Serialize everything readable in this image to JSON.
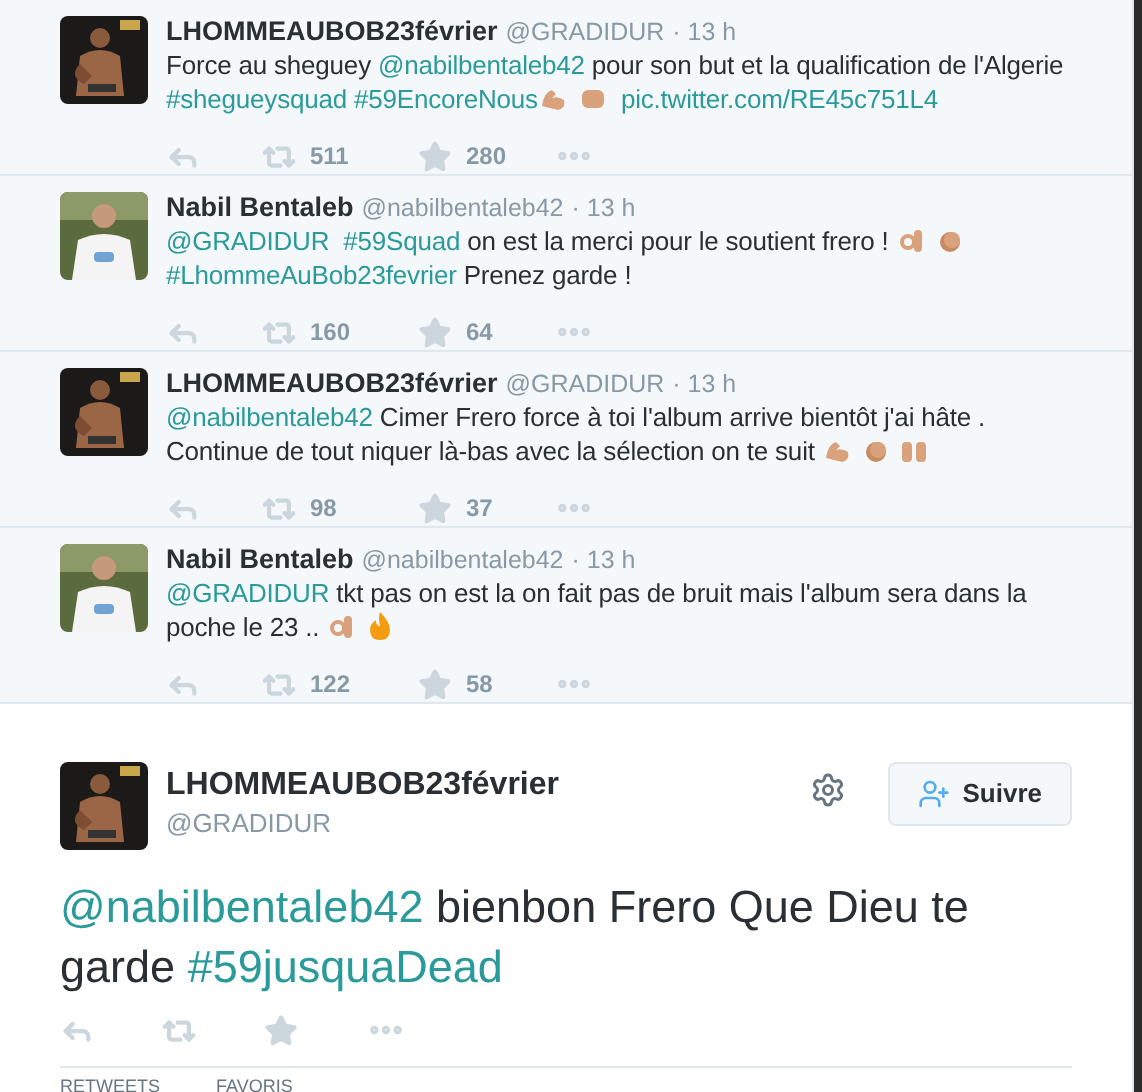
{
  "replies": [
    {
      "name": "LHOMMEAUBOB23février",
      "handle": "@GRADIDUR",
      "time": "· 13 h",
      "segments": [
        {
          "kind": "text",
          "text": "Force au sheguey "
        },
        {
          "kind": "link",
          "text": "@nabilbentaleb42"
        },
        {
          "kind": "text",
          "text": " pour son but et la qualification de l'Algerie "
        },
        {
          "kind": "link",
          "text": "#shegueysquad #59EncoreNous"
        },
        {
          "kind": "muscle"
        },
        {
          "kind": "fist"
        },
        {
          "kind": "link",
          "text": " pic.twitter.com/RE45c751L4"
        }
      ],
      "retweets": "511",
      "favorites": "280"
    },
    {
      "name": "Nabil Bentaleb",
      "handle": "@nabilbentaleb42",
      "time": "· 13 h",
      "segments": [
        {
          "kind": "link",
          "text": "@GRADIDUR  #59Squad"
        },
        {
          "kind": "text",
          "text": " on est la merci pour le soutient frero ! "
        },
        {
          "kind": "ok"
        },
        {
          "kind": "clap"
        },
        {
          "kind": "link",
          "text": "#LhommeAuBob23fevrier"
        },
        {
          "kind": "text",
          "text": " Prenez garde !"
        }
      ],
      "retweets": "160",
      "favorites": "64"
    },
    {
      "name": "LHOMMEAUBOB23février",
      "handle": "@GRADIDUR",
      "time": "· 13 h",
      "segments": [
        {
          "kind": "link",
          "text": "@nabilbentaleb42"
        },
        {
          "kind": "text",
          "text": " Cimer Frero force à toi l'album arrive bientôt j'ai hâte . Continue de tout niquer là-bas avec la sélection on te suit "
        },
        {
          "kind": "muscle"
        },
        {
          "kind": "clap"
        },
        {
          "kind": "raised"
        }
      ],
      "retweets": "98",
      "favorites": "37"
    },
    {
      "name": "Nabil Bentaleb",
      "handle": "@nabilbentaleb42",
      "time": "· 13 h",
      "segments": [
        {
          "kind": "link",
          "text": "@GRADIDUR"
        },
        {
          "kind": "text",
          "text": " tkt pas on est la on fait pas de bruit mais l'album sera dans la poche le 23 .. "
        },
        {
          "kind": "ok"
        },
        {
          "kind": "fire"
        }
      ],
      "retweets": "122",
      "favorites": "58"
    }
  ],
  "main": {
    "name": "LHOMMEAUBOB23février",
    "handle": "@GRADIDUR",
    "follow_label": "Suivre",
    "segments": [
      {
        "kind": "link",
        "text": "@nabilbentaleb42"
      },
      {
        "kind": "text",
        "text": " bienbon Frero Que Dieu te garde "
      },
      {
        "kind": "link",
        "text": "#59jusquaDead"
      }
    ],
    "stats": [
      "RETWEETS",
      "FAVORIS"
    ]
  }
}
